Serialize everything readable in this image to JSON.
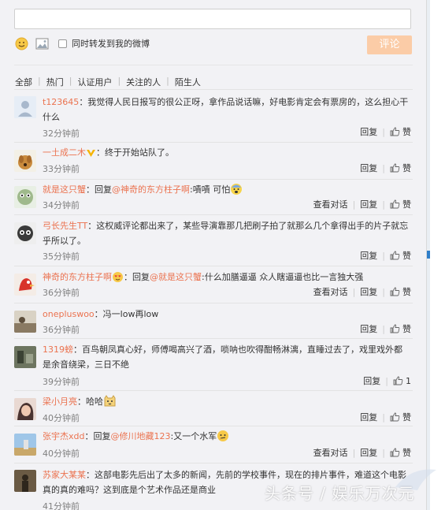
{
  "composer": {
    "value": "",
    "repost_label": "同时转发到我的微博",
    "submit_label": "评论"
  },
  "filters": [
    "全部",
    "热门",
    "认证用户",
    "关注的人",
    "陌生人"
  ],
  "comments": [
    {
      "user": "t123645",
      "pre": "：我觉得人民日报写的很公正呀，拿作品说话嘛，好电影肯定会有票房的，这么担心干什么",
      "time": "32分钟前",
      "reply": "回复",
      "like": "赞",
      "view": ""
    },
    {
      "user": "一土成二木",
      "pre": "：终于开始站队了。",
      "time": "33分钟前",
      "reply": "回复",
      "like": "赞",
      "view": ""
    },
    {
      "user": "就是这只蟹",
      "pre": "：回复",
      "at": "@神奇的东方柱子啊",
      "post": ":嘖嘖 可怕",
      "time": "34分钟前",
      "reply": "回复",
      "like": "赞",
      "view": "查看对话"
    },
    {
      "user": "弓长先生TT",
      "pre": "：这权威评论都出来了，某些导演靠那几把刷子拍了就那么几个拿得出手的片子就忘乎所以了。",
      "time": "35分钟前",
      "reply": "回复",
      "like": "赞",
      "view": ""
    },
    {
      "user": "神奇的东方柱子啊",
      "pre": "：回复",
      "at": "@就是这只蟹",
      "post": ":什么加膳逼逼 众人瞎逼逼也比一言独大强",
      "time": "36分钟前",
      "reply": "回复",
      "like": "赞",
      "view": "查看对话"
    },
    {
      "user": "onepluswoo",
      "pre": "：冯一low再low",
      "time": "36分钟前",
      "reply": "回复",
      "like": "赞",
      "view": ""
    },
    {
      "user": "1319螃",
      "pre": "：百鸟朝凤真心好，师傅喝高兴了酒，唢呐也吹得酣畅淋漓，直睡过去了，戏里戏外都是余音绕梁，三日不绝",
      "time": "39分钟前",
      "reply": "回复",
      "like": "1",
      "view": ""
    },
    {
      "user": "梁小月亮",
      "pre": "：哈哈",
      "time": "40分钟前",
      "reply": "回复",
      "like": "赞",
      "view": ""
    },
    {
      "user": "张宇杰xdd",
      "pre": "：回复",
      "at": "@修川地藏123",
      "post": ":又一个水军",
      "time": "40分钟前",
      "reply": "回复",
      "like": "赞",
      "view": "查看对话"
    },
    {
      "user": "苏家大某某",
      "pre": "：这部电影先后出了太多的新闻，先前的学校事件，现在的排片事件，难道这个电影真的真的难吗？这到底是个艺术作品还是商业",
      "time": "41分钟前",
      "reply": "",
      "like": "",
      "view": ""
    }
  ],
  "watermark": "头条号 / 娱乐万次元",
  "colors": {
    "accent": "#eb7350",
    "submit": "#fbcca7"
  }
}
